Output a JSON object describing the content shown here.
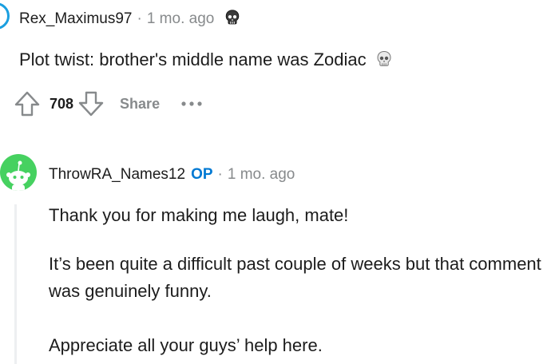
{
  "comment": {
    "username": "Rex_Maximus97",
    "separator": "·",
    "time": "1 mo. ago",
    "flair_icon": "skull-icon",
    "body": "Plot twist: brother's middle name was Zodiac",
    "body_emoji": "skull-emoji",
    "score": "708",
    "share_label": "Share"
  },
  "reply": {
    "username": "ThrowRA_Names12",
    "op_badge": "OP",
    "separator": "·",
    "time": "1 mo. ago",
    "paragraphs": [
      "Thank you for making me laugh, mate!",
      "It’s been quite a difficult past couple of weeks but that comment was genuinely funny.",
      "Appreciate all your guys’ help here."
    ]
  },
  "colors": {
    "text": "#1c1c1c",
    "meta": "#878a8c",
    "op": "#0079d3",
    "avatar_green": "#46d160",
    "avatar_ring": "#1a9fe0",
    "thread_line": "#edeff1"
  }
}
